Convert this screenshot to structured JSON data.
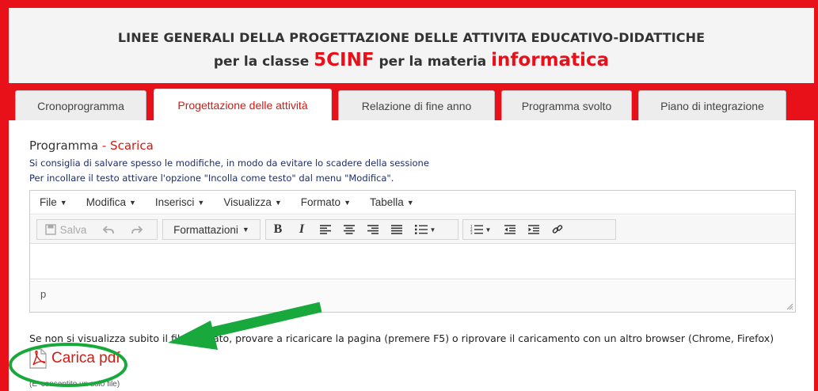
{
  "header": {
    "title_line1": "LINEE GENERALI DELLA PROGETTAZIONE DELLE ATTIVITA EDUCATIVO-DIDATTICHE",
    "title_line2_a": "per la classe ",
    "class_name": "5CINF",
    "title_line2_b": " per la materia ",
    "subject": "informatica"
  },
  "tabs": [
    {
      "label": "Cronoprogramma",
      "active": false
    },
    {
      "label": "Progettazione delle attività",
      "active": true
    },
    {
      "label": "Relazione di fine anno",
      "active": false
    },
    {
      "label": "Programma svolto",
      "active": false
    },
    {
      "label": "Piano di integrazione",
      "active": false
    }
  ],
  "program": {
    "title": "Programma",
    "separator": " - ",
    "download_link": "Scarica",
    "hint1": "Si consiglia di salvare spesso le modifiche, in modo da evitare lo scadere della sessione",
    "hint2": "Per incollare il testo attivare l'opzione \"Incolla come testo\" dal menu \"Modifica\"."
  },
  "editor": {
    "menus": [
      "File",
      "Modifica",
      "Inserisci",
      "Visualizza",
      "Formato",
      "Tabella"
    ],
    "toolbar": {
      "save_label": "Salva",
      "formats_label": "Formattazioni",
      "bold_label": "B",
      "italic_label": "I",
      "icons": [
        "save-icon",
        "undo-icon",
        "redo-icon",
        "align-left-icon",
        "align-center-icon",
        "align-right-icon",
        "align-justify-icon",
        "bullet-list-icon",
        "numbered-list-icon",
        "outdent-icon",
        "indent-icon",
        "link-icon"
      ]
    },
    "content": "",
    "path": "p"
  },
  "upload": {
    "note": "Se non si visualizza subito il file caricato, provare a ricaricare la pagina (premere F5) o riprovare il caricamento con un altro browser (Chrome, Firefox)",
    "button_label": "Carica pdf",
    "small_note": "(E' consentito un solo file)"
  },
  "colors": {
    "brand_red": "#e8111a",
    "link_red": "#d41a12",
    "annotation_green": "#19a83b",
    "hint_navy": "#1b2d6b"
  }
}
